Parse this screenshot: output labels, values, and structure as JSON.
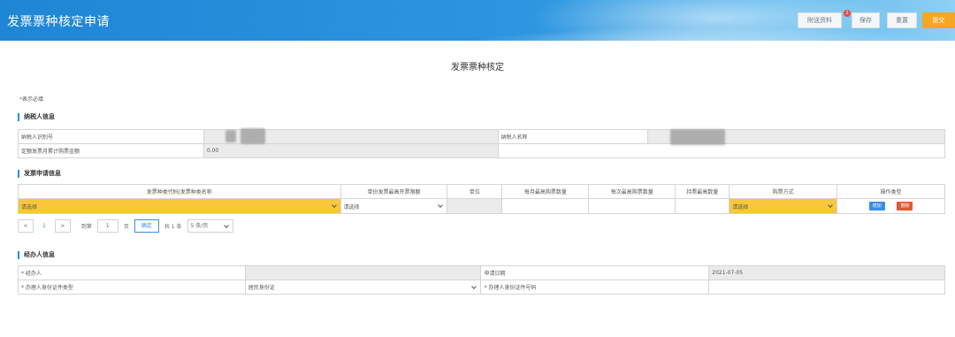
{
  "header": {
    "title": "发票票种核定申请",
    "buttons": {
      "attach": "附送资料",
      "attach_badge": "2",
      "save": "保存",
      "reset": "重置",
      "submit": "提交"
    }
  },
  "page_title": "发票票种核定",
  "required_note": "表示必填",
  "taxpayer": {
    "heading": "纳税人信息",
    "tax_id_label": "纳税人识别号",
    "name_label": "纳税人名称",
    "max_amount_label": "定额发票月累计购票金额",
    "max_amount_value": "0.00"
  },
  "invoice_apply": {
    "heading": "发票申请信息",
    "columns": [
      "发票种类代码|发票种类名称",
      "单份发票最高开票限额",
      "单位",
      "每月最高购票数量",
      "每次最高购票数量",
      "持票最高数量",
      "购票方式",
      "操作类型"
    ],
    "row": {
      "kind_select": "请选择",
      "limit_select": "请选择",
      "method_select": "请选择",
      "add_button": "增加",
      "delete_button": "删除"
    }
  },
  "pager": {
    "prev": "<",
    "current": "1",
    "next": ">",
    "goto_label": "到第",
    "page_input": "1",
    "page_unit": "页",
    "confirm": "确定",
    "total": "共 1 条",
    "page_size": "5 条/页"
  },
  "agent": {
    "heading": "经办人信息",
    "agent_label": "* 经办人",
    "apply_date_label": "申请日期",
    "apply_date_value": "2021-07-05",
    "id_type_label": "* 办理人身份证件类型",
    "id_type_value": "居民身份证",
    "id_no_label": "* 办理人身份证件号码"
  }
}
